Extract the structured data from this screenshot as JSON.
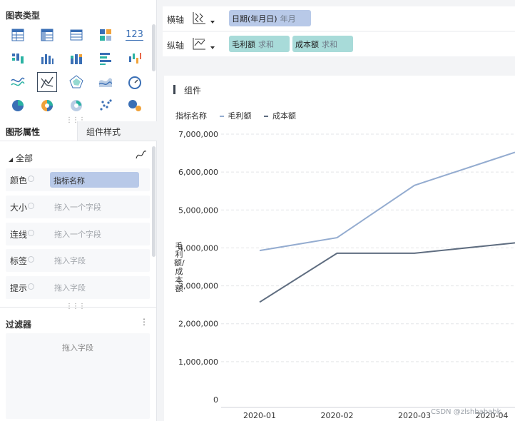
{
  "chart_types": {
    "title": "图表类型",
    "icons": [
      "table-icon",
      "crosstable-icon",
      "detail-table-icon",
      "color-table-icon",
      "kpi-icon",
      "bar-grouped-icon",
      "bar-icon",
      "bar-stacked-icon",
      "horizontal-bar-icon",
      "range-bar-icon",
      "wave-line-icon",
      "line-chart-icon",
      "radar-icon",
      "area-icon",
      "gauge-icon",
      "pie-icon",
      "donut-icon",
      "rose-icon",
      "scatter-icon",
      "bubble-icon"
    ],
    "kpi_text": "123",
    "selected_index": 11
  },
  "tabs": {
    "attrs": "图形属性",
    "style": "组件样式"
  },
  "attrs": {
    "all_label": "全部",
    "rows": [
      {
        "label": "颜色",
        "value": "指标名称"
      },
      {
        "label": "大小",
        "placeholder": "拖入一个字段"
      },
      {
        "label": "连线",
        "placeholder": "拖入一个字段"
      },
      {
        "label": "标签",
        "placeholder": "拖入字段"
      },
      {
        "label": "提示",
        "placeholder": "拖入字段"
      }
    ]
  },
  "filter": {
    "title": "过滤器",
    "placeholder": "拖入字段",
    "more": "⋮"
  },
  "x_axis": {
    "label": "横轴",
    "field": "日期(年月日)",
    "agg": "年月"
  },
  "y_axis": {
    "label": "纵轴",
    "fields": [
      {
        "name": "毛利额",
        "agg": "求和"
      },
      {
        "name": "成本额",
        "agg": "求和"
      }
    ]
  },
  "component": {
    "title": "组件"
  },
  "legend": {
    "title": "指标名称",
    "items": [
      "毛利额",
      "成本额"
    ]
  },
  "watermark": "CSDN @zlshbababk",
  "colors": {
    "series1": "#94acd0",
    "series2": "#5f6d80",
    "blue_pill": "#b8c9e8",
    "green_pill": "#a8dbd9"
  },
  "chart_data": {
    "type": "line",
    "x": [
      "2020-01",
      "2020-02",
      "2020-03",
      "2020-04"
    ],
    "series": [
      {
        "name": "毛利额",
        "values": [
          3930000,
          4270000,
          5650000,
          6320000
        ]
      },
      {
        "name": "成本额",
        "values": [
          2570000,
          3860000,
          3860000,
          4070000
        ]
      }
    ],
    "ylabel": "毛利额/成本额",
    "yticks": [
      "7,000,000",
      "6,000,000",
      "5,000,000",
      "4,000,000",
      "3,000,000",
      "2,000,000",
      "1,000,000",
      "0"
    ],
    "ylim": [
      0,
      7000000
    ],
    "grid": true,
    "legend_position": "top-left"
  }
}
